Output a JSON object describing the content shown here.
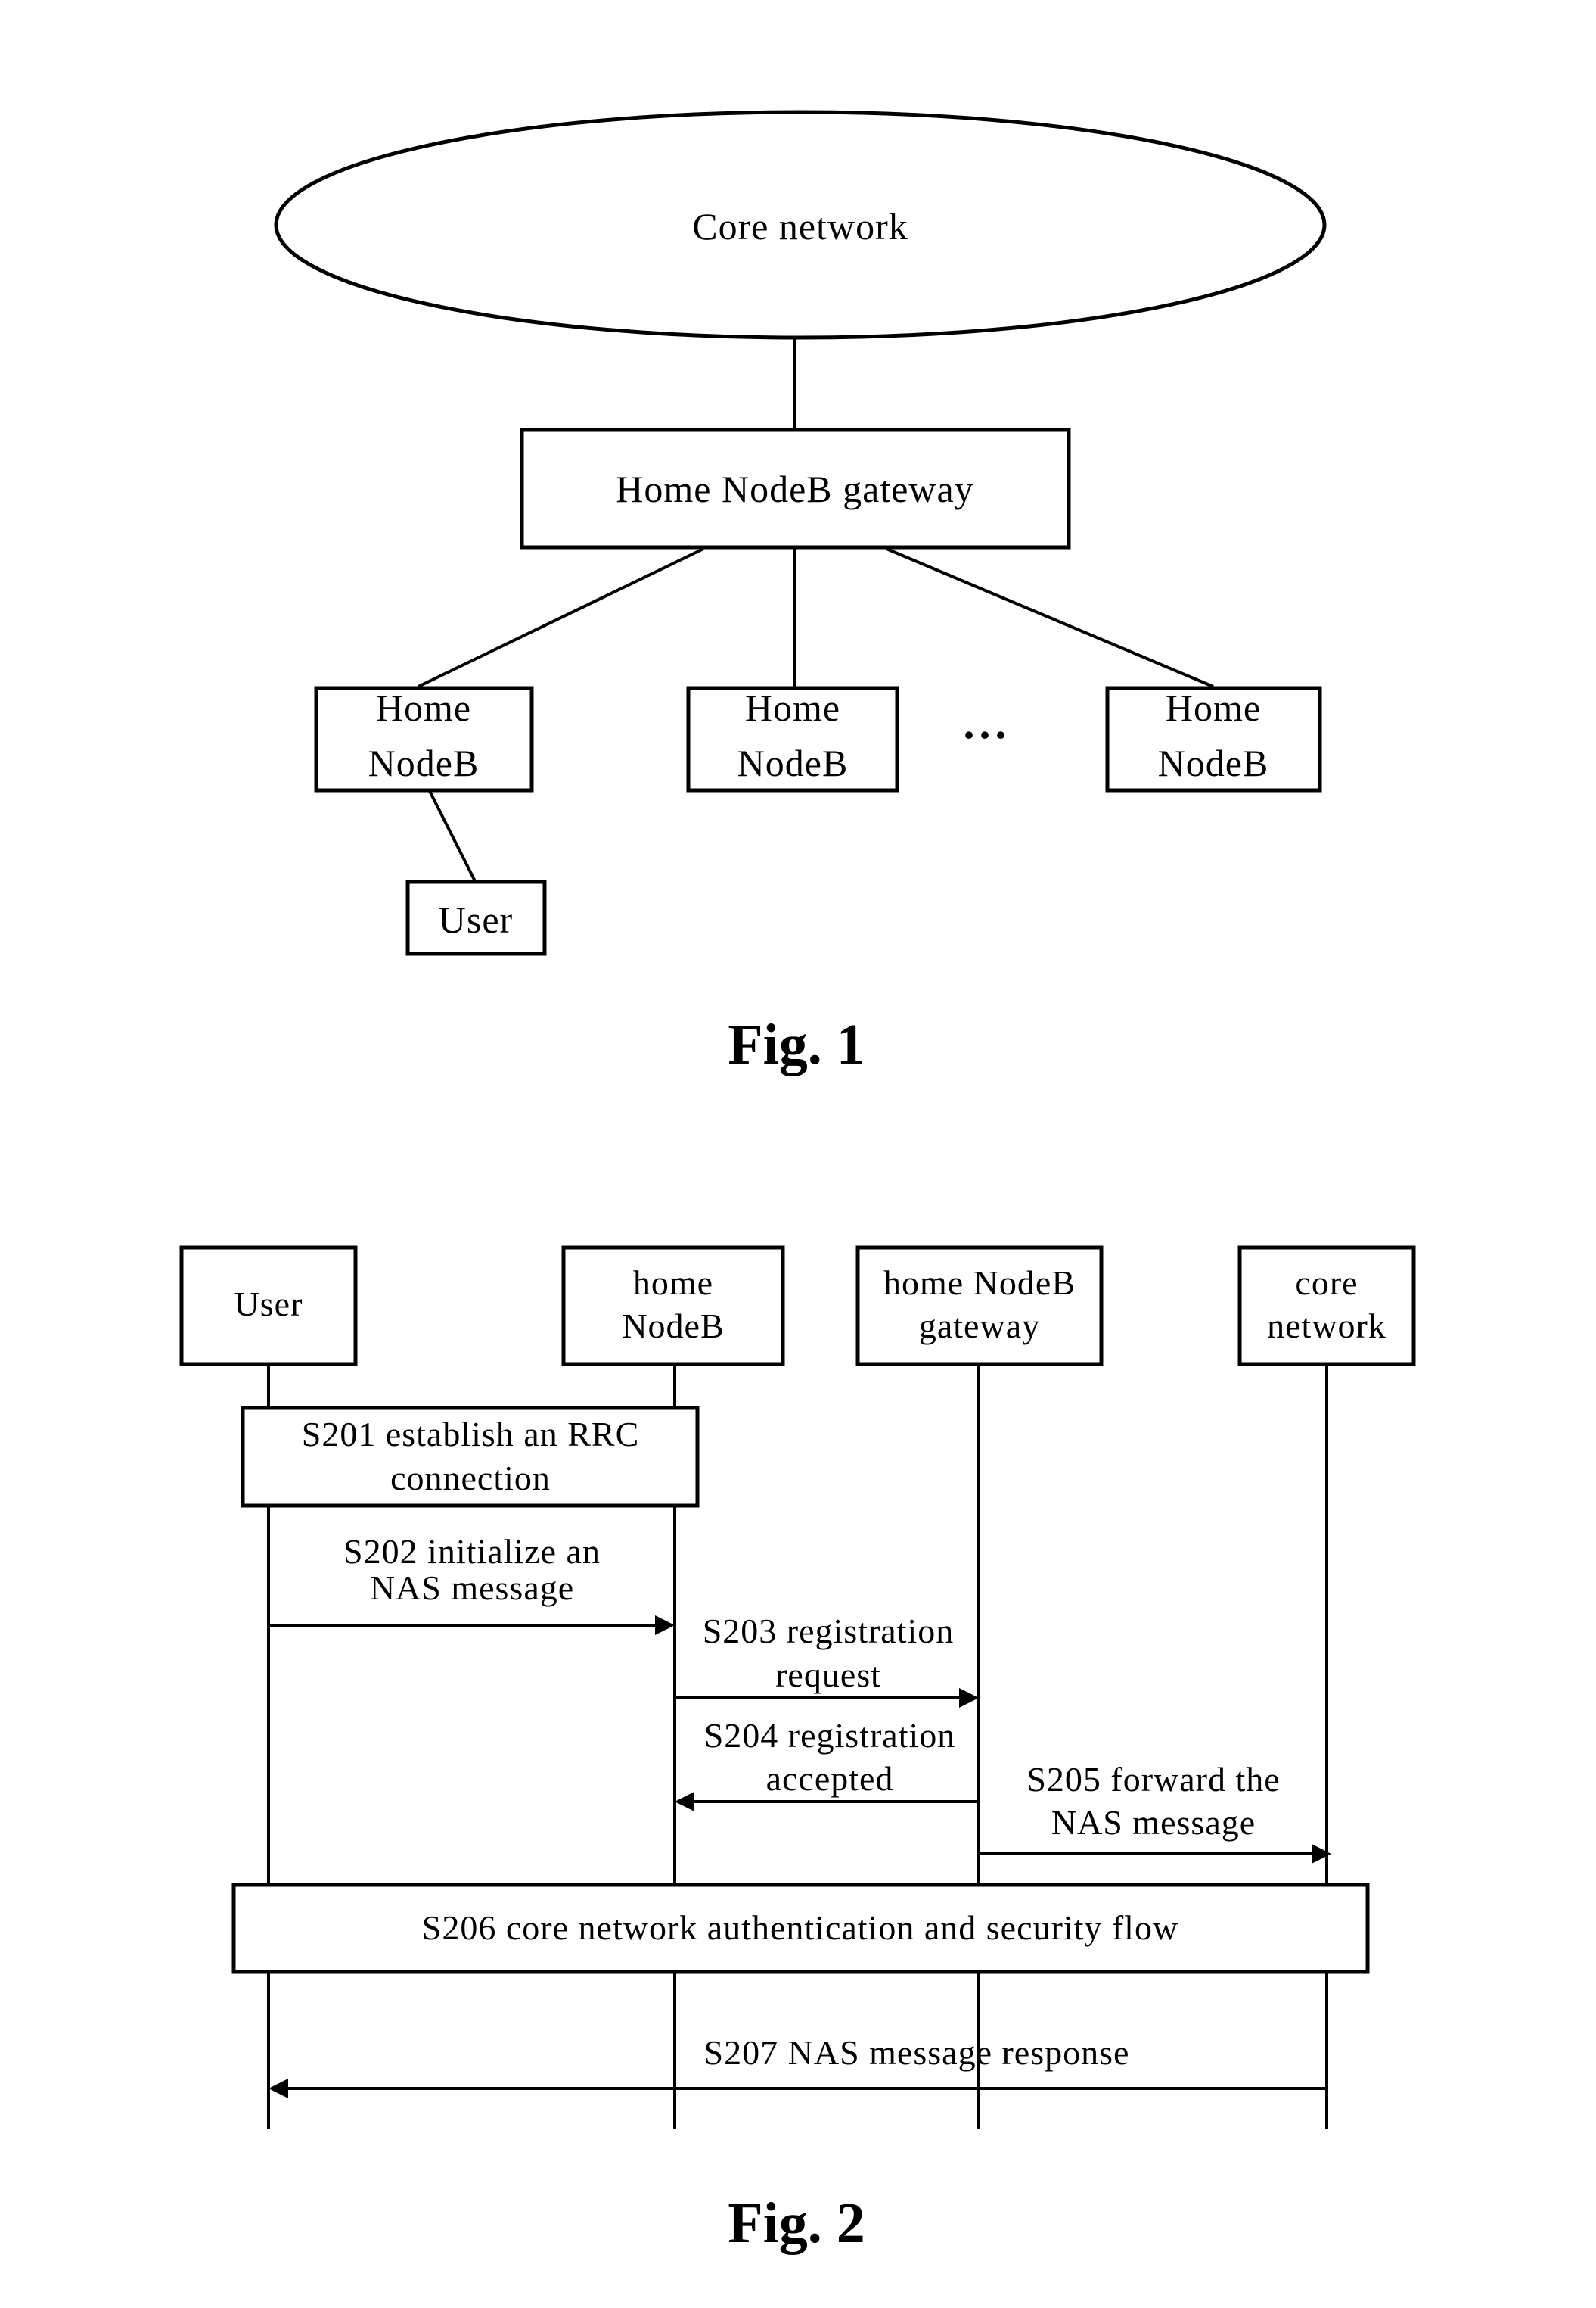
{
  "figure1": {
    "caption": "Fig. 1",
    "core_network": "Core network",
    "gateway": "Home NodeB gateway",
    "home_nodebs": [
      {
        "line1": "Home",
        "line2": "NodeB"
      },
      {
        "line1": "Home",
        "line2": "NodeB"
      },
      {
        "line1": "Home",
        "line2": "NodeB"
      }
    ],
    "ellipsis": "...",
    "user": "User"
  },
  "figure2": {
    "caption": "Fig. 2",
    "participants": [
      {
        "id": "user",
        "line1": "User",
        "line2": ""
      },
      {
        "id": "home-nodeb",
        "line1": "home",
        "line2": "NodeB"
      },
      {
        "id": "gateway",
        "line1": "home NodeB",
        "line2": "gateway"
      },
      {
        "id": "core-network",
        "line1": "core",
        "line2": "network"
      }
    ],
    "steps": [
      {
        "id": "S201",
        "type": "box",
        "from": "user",
        "to": "home-nodeb",
        "line1": "S201 establish an RRC",
        "line2": "connection"
      },
      {
        "id": "S202",
        "type": "message",
        "from": "user",
        "to": "home-nodeb",
        "line1": "S202 initialize an",
        "line2": "NAS message"
      },
      {
        "id": "S203",
        "type": "message",
        "from": "home-nodeb",
        "to": "gateway",
        "line1": "S203 registration",
        "line2": "request"
      },
      {
        "id": "S204",
        "type": "message",
        "from": "gateway",
        "to": "home-nodeb",
        "line1": "S204 registration",
        "line2": "accepted"
      },
      {
        "id": "S205",
        "type": "message",
        "from": "gateway",
        "to": "core-network",
        "line1": "S205 forward the",
        "line2": "NAS message"
      },
      {
        "id": "S206",
        "type": "box",
        "from": "user",
        "to": "core-network",
        "line1": "S206 core network authentication and security flow",
        "line2": ""
      },
      {
        "id": "S207",
        "type": "message",
        "from": "core-network",
        "to": "user",
        "line1": "S207 NAS message response",
        "line2": ""
      }
    ]
  }
}
